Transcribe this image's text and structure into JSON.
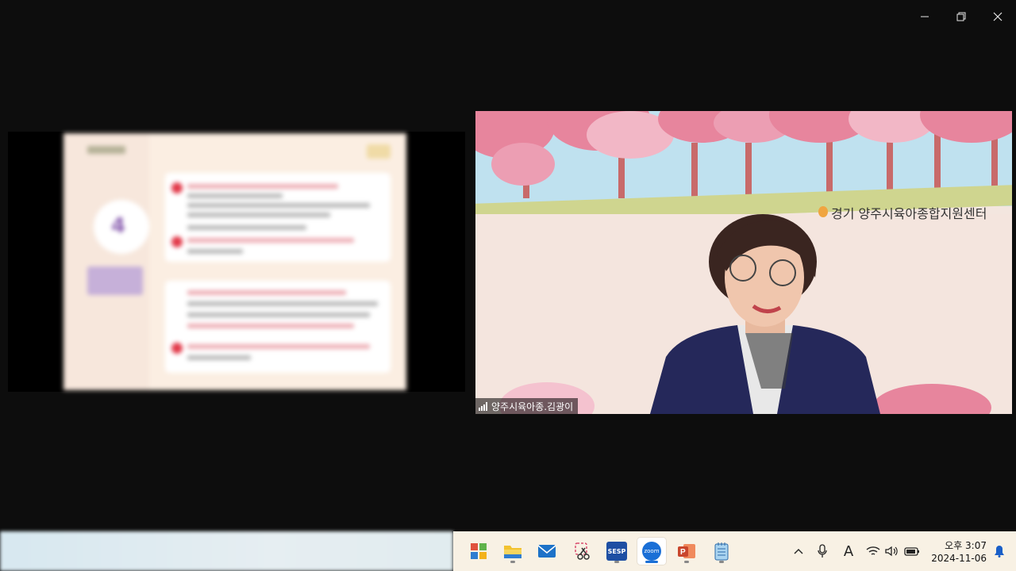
{
  "window_controls": {
    "minimize_icon": "minimize-icon",
    "restore_icon": "restore-icon",
    "close_icon": "close-icon"
  },
  "video": {
    "participant_name": "양주시육아종.김광이",
    "background_sign": "경기 양주시육아종합지원센터",
    "signal_icon": "signal-bars-icon"
  },
  "shared_slide": {
    "badge_text": "4"
  },
  "taskbar": {
    "apps": [
      {
        "name": "start",
        "icon": "windows-start-icon"
      },
      {
        "name": "file-explorer",
        "icon": "folder-icon"
      },
      {
        "name": "mail",
        "icon": "mail-icon"
      },
      {
        "name": "snipping-tool",
        "icon": "scissors-icon"
      },
      {
        "name": "sesp",
        "icon": "sesp-icon",
        "label": "SESP"
      },
      {
        "name": "zoom",
        "icon": "zoom-icon",
        "label": "zoom"
      },
      {
        "name": "powerpoint",
        "icon": "powerpoint-icon"
      },
      {
        "name": "notepad",
        "icon": "notepad-icon"
      }
    ],
    "tray": {
      "ime_label": "A",
      "time": "오후 3:07",
      "date": "2024-11-06"
    },
    "colors": {
      "zoom": "#1a6fd6",
      "powerpoint": "#c9462c"
    }
  }
}
